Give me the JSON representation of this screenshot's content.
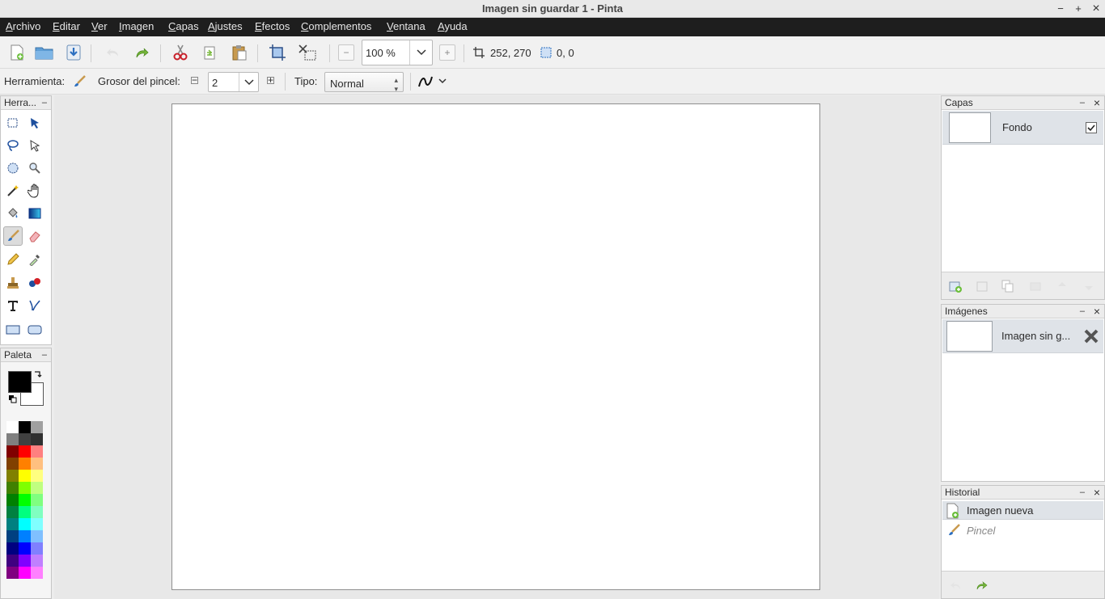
{
  "window": {
    "title": "Imagen sin guardar 1 - Pinta",
    "minimize": "−",
    "maximize": "+",
    "close": "×"
  },
  "menu": [
    "Archivo",
    "Editar",
    "Ver",
    "Imagen",
    "Capas",
    "Ajustes",
    "Efectos",
    "Complementos",
    "Ventana",
    "Ayuda"
  ],
  "toolbar": {
    "zoom": "100 %",
    "zoom_out": "−",
    "zoom_in": "+",
    "image_size": "252, 270",
    "cursor_pos": "0, 0"
  },
  "tool_options": {
    "tool_label": "Herramienta:",
    "brush_width_label": "Grosor del pincel:",
    "brush_width": "2",
    "type_label": "Tipo:",
    "type_value": "Normal",
    "minus": "−",
    "plus": "+"
  },
  "tools_panel": {
    "title": "Herra...",
    "collapse": "–"
  },
  "palette_panel": {
    "title": "Paleta",
    "collapse": "–",
    "primary_color": "#000000",
    "secondary_color": "#ffffff",
    "colors": [
      [
        "#ffffff",
        "#000000",
        "#a0a0a0"
      ],
      [
        "#808080",
        "#404040",
        "#303030"
      ],
      [
        "#800000",
        "#ff0000",
        "#ff8080"
      ],
      [
        "#804000",
        "#ff8000",
        "#ffc080"
      ],
      [
        "#808000",
        "#ffff00",
        "#ffff80"
      ],
      [
        "#408000",
        "#80ff00",
        "#c0ff80"
      ],
      [
        "#008000",
        "#00ff00",
        "#80ff80"
      ],
      [
        "#008040",
        "#00ff80",
        "#80ffc0"
      ],
      [
        "#008080",
        "#00ffff",
        "#80ffff"
      ],
      [
        "#004080",
        "#0080ff",
        "#80c0ff"
      ],
      [
        "#000080",
        "#0000ff",
        "#8080ff"
      ],
      [
        "#400080",
        "#8000ff",
        "#c080ff"
      ],
      [
        "#800080",
        "#ff00ff",
        "#ff80ff"
      ]
    ]
  },
  "layers_panel": {
    "title": "Capas",
    "minimize": "–",
    "close": "×",
    "layer_name": "Fondo"
  },
  "images_panel": {
    "title": "Imágenes",
    "minimize": "–",
    "close": "×",
    "image_name": "Imagen sin g..."
  },
  "history_panel": {
    "title": "Historial",
    "minimize": "–",
    "close": "×",
    "items": [
      "Imagen nueva",
      "Pincel"
    ]
  },
  "colors": {
    "menubar_bg": "#1e1e1e",
    "selection_bg": "#dfe3e8"
  }
}
